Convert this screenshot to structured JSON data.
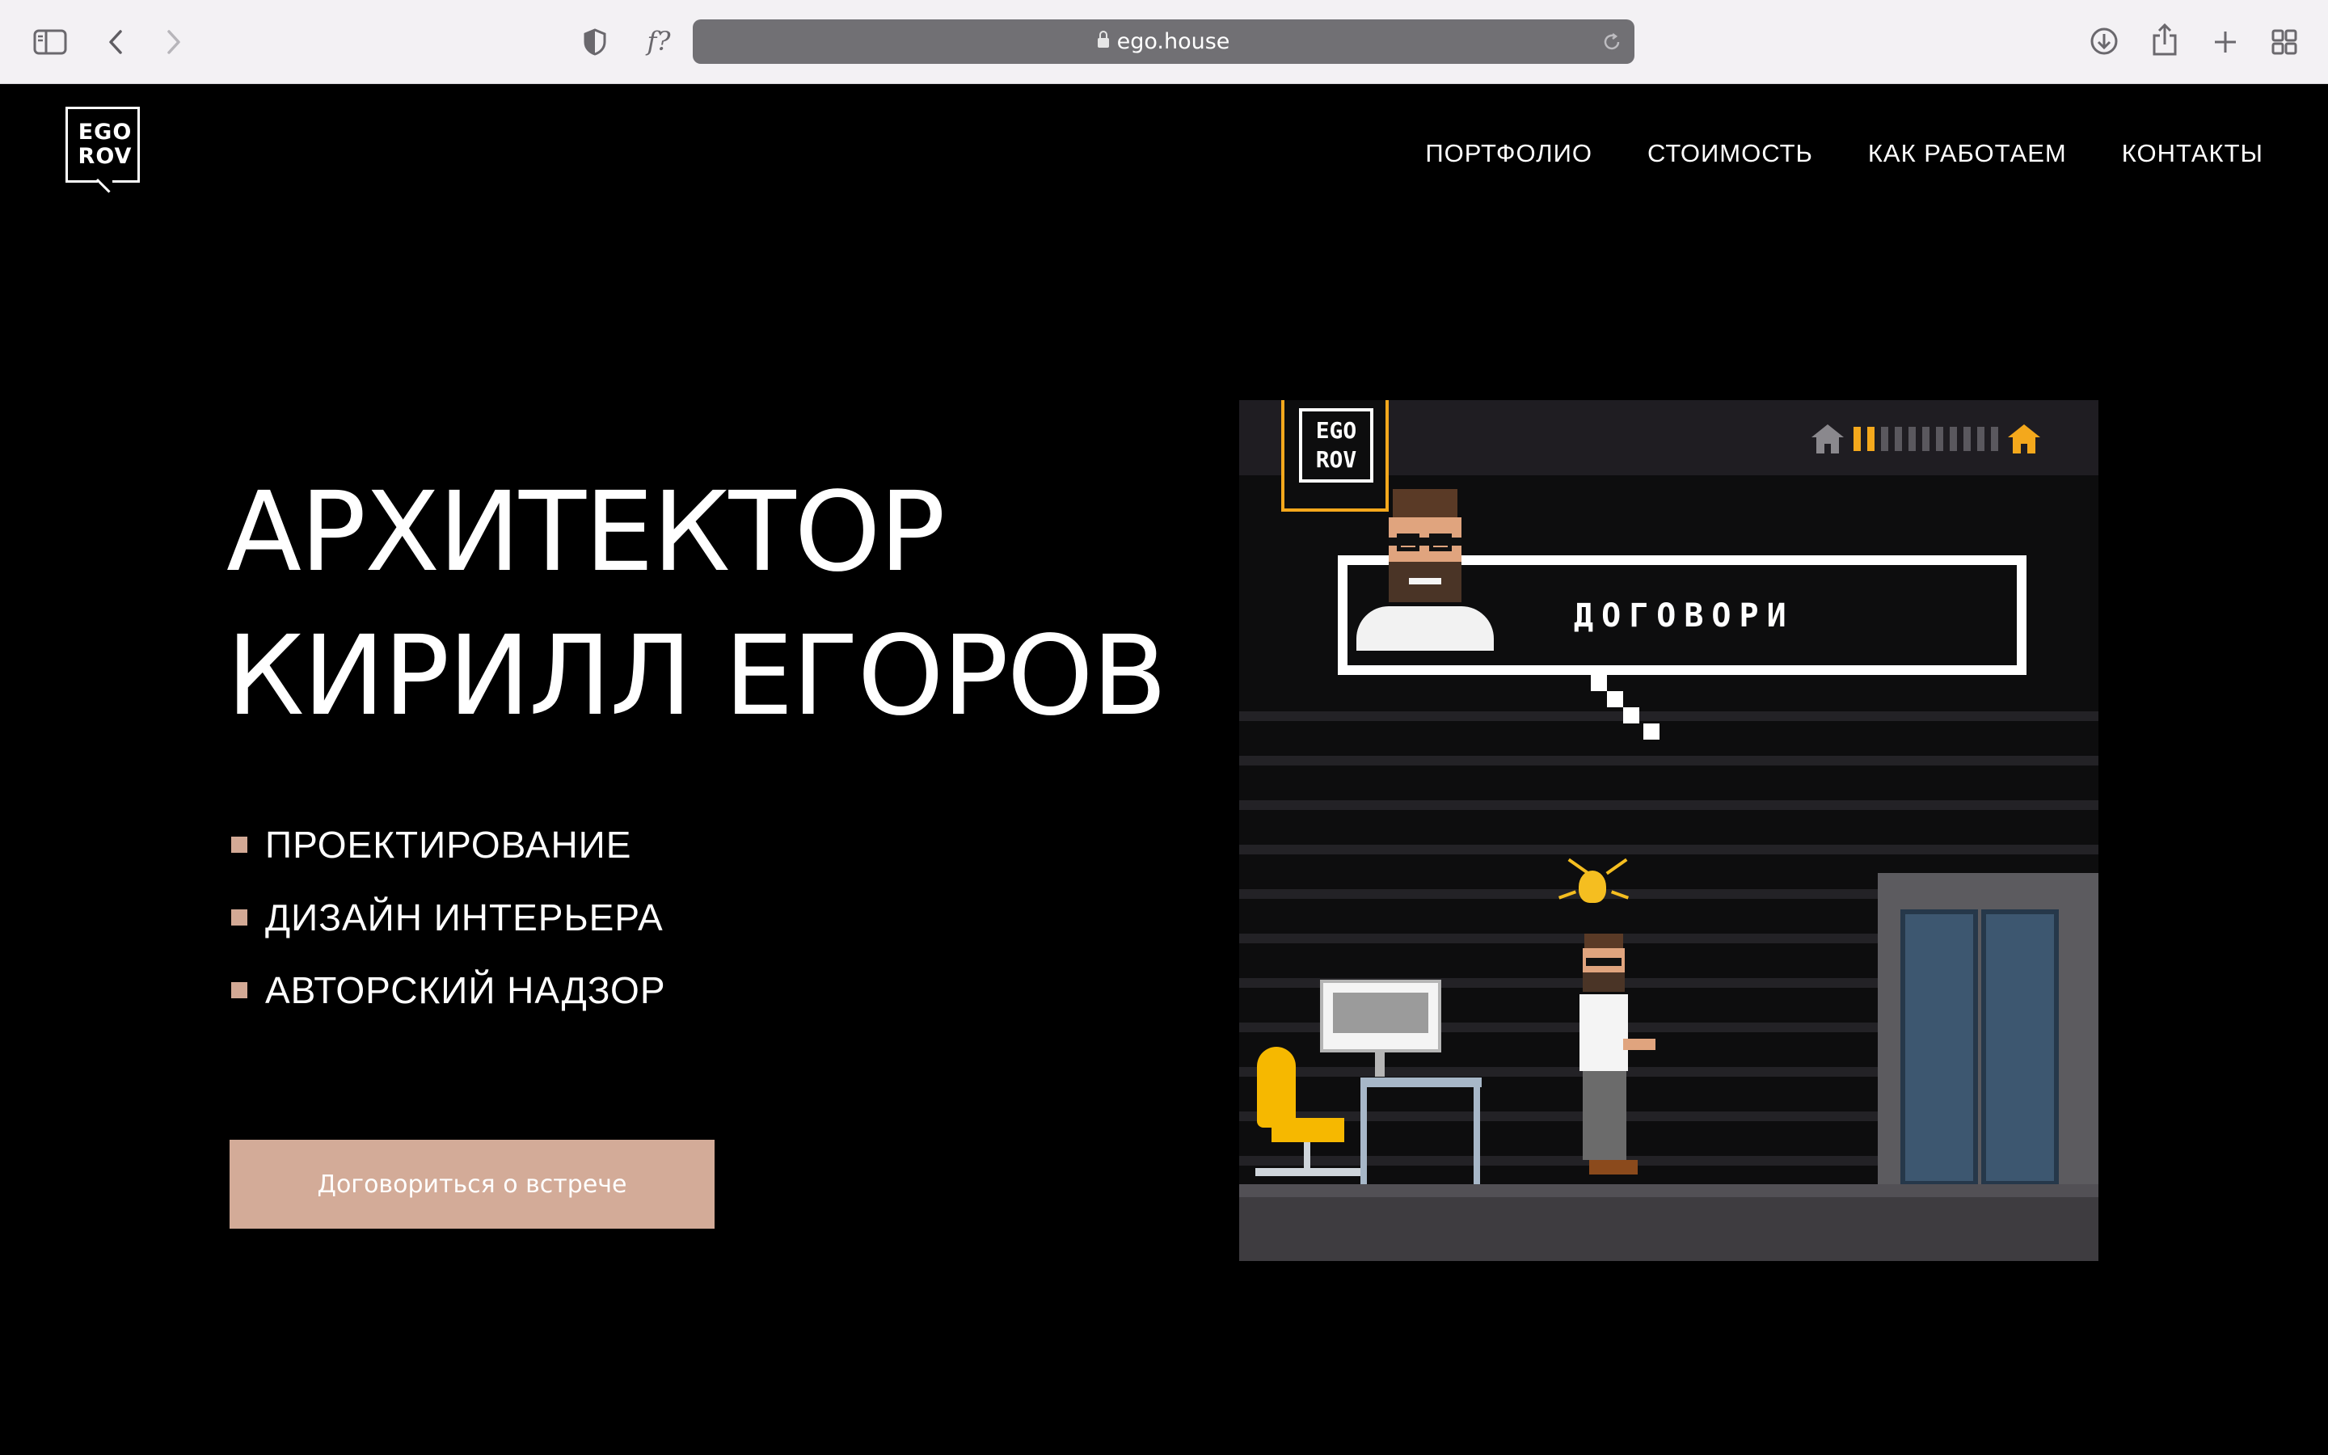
{
  "browser": {
    "url": "ego.house",
    "format_icon": "f?",
    "icons": [
      "sidebar-icon",
      "back-icon",
      "forward-icon",
      "privacy-shield-icon",
      "lock-icon",
      "reload-icon",
      "download-icon",
      "share-icon",
      "new-tab-icon",
      "tab-overview-icon"
    ]
  },
  "site": {
    "logo": {
      "line1": "EGO",
      "line2": "ROV"
    },
    "nav": [
      "ПОРТФОЛИО",
      "СТОИМОСТЬ",
      "КАК РАБОТАЕМ",
      "КОНТАКТЫ"
    ],
    "hero": {
      "title_line1": "АРХИТЕКТОР",
      "title_line2": "КИРИЛЛ ЕГОРОВ",
      "services": [
        "ПРОЕКТИРОВАНИЕ",
        "ДИЗАЙН ИНТЕРЬЕРА",
        "АВТОРСКИЙ НАДЗОР"
      ],
      "cta": "Договориться о встрече"
    },
    "game": {
      "logo_line1": "EGO",
      "logo_line2": "ROV",
      "speech": "ДОГОВОРИ",
      "progress_filled": 2,
      "progress_total": 11
    }
  },
  "colors": {
    "accent": "#d3ab98",
    "bullet": "#d3a995",
    "game_orange": "#f4a81c",
    "browser_bar": "#f3f1f4",
    "url_field": "#717074"
  }
}
